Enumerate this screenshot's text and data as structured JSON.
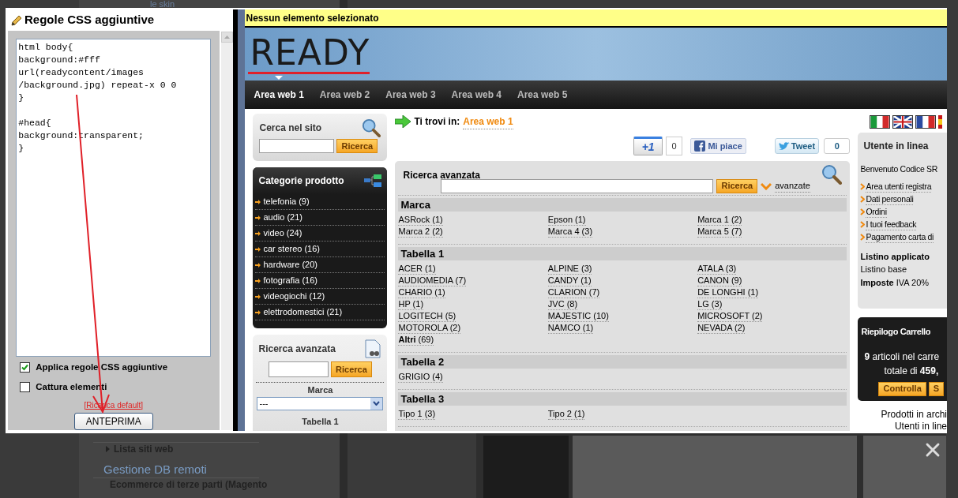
{
  "background": {
    "top_text": "le skin",
    "menu": [
      {
        "kind": "sub",
        "text": "Lista siti web"
      },
      {
        "kind": "link",
        "text": "Gestione DB remoti"
      },
      {
        "kind": "sub",
        "text": "Ecommerce di terze parti (Magento"
      }
    ]
  },
  "css_panel": {
    "title": "Regole CSS aggiuntive",
    "code": "html body{\nbackground:#fff\nurl(readycontent/images\n/background.jpg) repeat-x 0 0\n}\n\n#head{\nbackground:transparent;\n}",
    "options": [
      {
        "label": "Applica regole CSS aggiuntive",
        "checked": true
      },
      {
        "label": "Cattura elementi",
        "checked": false
      }
    ],
    "reset_link": "[Ricarica default]",
    "preview_button": "ANTEPRIMA"
  },
  "preview": {
    "status": "Nessun elemento selezionato",
    "logo": "READY",
    "nav": [
      {
        "label": "Area web 1",
        "selected": true
      },
      {
        "label": "Area web 2",
        "selected": false
      },
      {
        "label": "Area web 3",
        "selected": false
      },
      {
        "label": "Area web 4",
        "selected": false
      },
      {
        "label": "Area web 5",
        "selected": false
      }
    ],
    "site_search": {
      "title": "Cerca nel sito",
      "button": "Ricerca"
    },
    "categories": {
      "title": "Categorie prodotto",
      "items": [
        "telefonia (9)",
        "audio (21)",
        "video (24)",
        "car stereo (16)",
        "hardware (20)",
        "fotografia (16)",
        "videogiochi (12)",
        "elettrodomestici (21)"
      ]
    },
    "side_search": {
      "title": "Ricerca avanzata",
      "button": "Ricerca",
      "field_label": "Marca",
      "select_value": "---",
      "next_label": "Tabella 1"
    },
    "breadcrumb": {
      "label": "Ti trovi in:",
      "current": "Area web 1"
    },
    "social": {
      "plus": "+1",
      "plus_count": "0",
      "like": "Mi piace",
      "tweet": "Tweet",
      "tweet_count": "0"
    },
    "advanced": {
      "title": "Ricerca avanzata",
      "button": "Ricerca",
      "more": "avanzate",
      "groups": [
        {
          "title": "Marca",
          "items": [
            "ASRock (1)",
            "Epson (1)",
            "Marca 1 (2)",
            "Marca 2 (2)",
            "Marca 4 (3)",
            "Marca 5 (7)"
          ]
        },
        {
          "title": "Tabella 1",
          "items": [
            "ACER (1)",
            "ALPINE (3)",
            "ATALA (3)",
            "AUDIOMEDIA (7)",
            "CANDY (1)",
            "CANON (9)",
            "CHARIO (1)",
            "CLARION (7)",
            "DE LONGHI (1)",
            "HP (1)",
            "JVC (8)",
            "LG (3)",
            "LOGITECH (5)",
            "MAJESTIC (10)",
            "MICROSOFT (2)",
            "MOTOROLA (2)",
            "NAMCO (1)",
            "NEVADA (2)",
            "**Altri** (69)"
          ]
        },
        {
          "title": "Tabella 2",
          "items": [
            "GRIGIO (4)"
          ]
        },
        {
          "title": "Tabella 3",
          "items": [
            "Tipo 1 (3)",
            "Tipo 2 (1)"
          ]
        }
      ]
    },
    "user": {
      "title": "Utente in linea",
      "welcome": "Benvenuto Codice SR",
      "links": [
        "Area utenti registra",
        "Dati personali",
        "Ordini",
        "I tuoi feedback",
        "Pagamento carta di"
      ],
      "price_title": "Listino applicato",
      "price_list": "Listino base",
      "tax": "**Imposte** IVA 20%"
    },
    "cart": {
      "title": "Riepilogo Carrello",
      "line1": "**9** articoli nel carre",
      "line2": "totale di **459,**",
      "buttons": [
        "Controlla",
        "S"
      ]
    },
    "footer_lines": [
      "Prodotti in archi",
      "Utenti in line"
    ]
  }
}
